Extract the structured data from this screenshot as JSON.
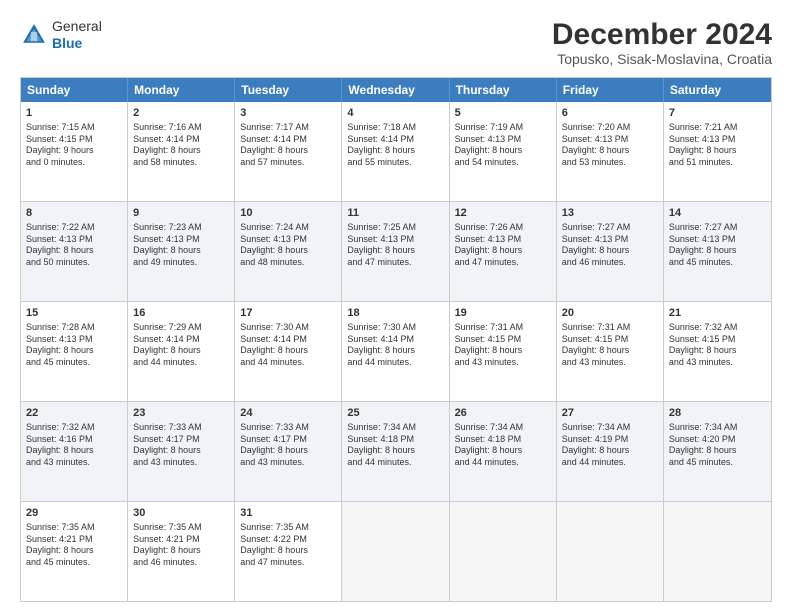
{
  "header": {
    "logo_general": "General",
    "logo_blue": "Blue",
    "title": "December 2024",
    "subtitle": "Topusko, Sisak-Moslavina, Croatia"
  },
  "weekdays": [
    "Sunday",
    "Monday",
    "Tuesday",
    "Wednesday",
    "Thursday",
    "Friday",
    "Saturday"
  ],
  "rows": [
    [
      {
        "day": "1",
        "lines": [
          "Sunrise: 7:15 AM",
          "Sunset: 4:15 PM",
          "Daylight: 9 hours",
          "and 0 minutes."
        ]
      },
      {
        "day": "2",
        "lines": [
          "Sunrise: 7:16 AM",
          "Sunset: 4:14 PM",
          "Daylight: 8 hours",
          "and 58 minutes."
        ]
      },
      {
        "day": "3",
        "lines": [
          "Sunrise: 7:17 AM",
          "Sunset: 4:14 PM",
          "Daylight: 8 hours",
          "and 57 minutes."
        ]
      },
      {
        "day": "4",
        "lines": [
          "Sunrise: 7:18 AM",
          "Sunset: 4:14 PM",
          "Daylight: 8 hours",
          "and 55 minutes."
        ]
      },
      {
        "day": "5",
        "lines": [
          "Sunrise: 7:19 AM",
          "Sunset: 4:13 PM",
          "Daylight: 8 hours",
          "and 54 minutes."
        ]
      },
      {
        "day": "6",
        "lines": [
          "Sunrise: 7:20 AM",
          "Sunset: 4:13 PM",
          "Daylight: 8 hours",
          "and 53 minutes."
        ]
      },
      {
        "day": "7",
        "lines": [
          "Sunrise: 7:21 AM",
          "Sunset: 4:13 PM",
          "Daylight: 8 hours",
          "and 51 minutes."
        ]
      }
    ],
    [
      {
        "day": "8",
        "lines": [
          "Sunrise: 7:22 AM",
          "Sunset: 4:13 PM",
          "Daylight: 8 hours",
          "and 50 minutes."
        ]
      },
      {
        "day": "9",
        "lines": [
          "Sunrise: 7:23 AM",
          "Sunset: 4:13 PM",
          "Daylight: 8 hours",
          "and 49 minutes."
        ]
      },
      {
        "day": "10",
        "lines": [
          "Sunrise: 7:24 AM",
          "Sunset: 4:13 PM",
          "Daylight: 8 hours",
          "and 48 minutes."
        ]
      },
      {
        "day": "11",
        "lines": [
          "Sunrise: 7:25 AM",
          "Sunset: 4:13 PM",
          "Daylight: 8 hours",
          "and 47 minutes."
        ]
      },
      {
        "day": "12",
        "lines": [
          "Sunrise: 7:26 AM",
          "Sunset: 4:13 PM",
          "Daylight: 8 hours",
          "and 47 minutes."
        ]
      },
      {
        "day": "13",
        "lines": [
          "Sunrise: 7:27 AM",
          "Sunset: 4:13 PM",
          "Daylight: 8 hours",
          "and 46 minutes."
        ]
      },
      {
        "day": "14",
        "lines": [
          "Sunrise: 7:27 AM",
          "Sunset: 4:13 PM",
          "Daylight: 8 hours",
          "and 45 minutes."
        ]
      }
    ],
    [
      {
        "day": "15",
        "lines": [
          "Sunrise: 7:28 AM",
          "Sunset: 4:13 PM",
          "Daylight: 8 hours",
          "and 45 minutes."
        ]
      },
      {
        "day": "16",
        "lines": [
          "Sunrise: 7:29 AM",
          "Sunset: 4:14 PM",
          "Daylight: 8 hours",
          "and 44 minutes."
        ]
      },
      {
        "day": "17",
        "lines": [
          "Sunrise: 7:30 AM",
          "Sunset: 4:14 PM",
          "Daylight: 8 hours",
          "and 44 minutes."
        ]
      },
      {
        "day": "18",
        "lines": [
          "Sunrise: 7:30 AM",
          "Sunset: 4:14 PM",
          "Daylight: 8 hours",
          "and 44 minutes."
        ]
      },
      {
        "day": "19",
        "lines": [
          "Sunrise: 7:31 AM",
          "Sunset: 4:15 PM",
          "Daylight: 8 hours",
          "and 43 minutes."
        ]
      },
      {
        "day": "20",
        "lines": [
          "Sunrise: 7:31 AM",
          "Sunset: 4:15 PM",
          "Daylight: 8 hours",
          "and 43 minutes."
        ]
      },
      {
        "day": "21",
        "lines": [
          "Sunrise: 7:32 AM",
          "Sunset: 4:15 PM",
          "Daylight: 8 hours",
          "and 43 minutes."
        ]
      }
    ],
    [
      {
        "day": "22",
        "lines": [
          "Sunrise: 7:32 AM",
          "Sunset: 4:16 PM",
          "Daylight: 8 hours",
          "and 43 minutes."
        ]
      },
      {
        "day": "23",
        "lines": [
          "Sunrise: 7:33 AM",
          "Sunset: 4:17 PM",
          "Daylight: 8 hours",
          "and 43 minutes."
        ]
      },
      {
        "day": "24",
        "lines": [
          "Sunrise: 7:33 AM",
          "Sunset: 4:17 PM",
          "Daylight: 8 hours",
          "and 43 minutes."
        ]
      },
      {
        "day": "25",
        "lines": [
          "Sunrise: 7:34 AM",
          "Sunset: 4:18 PM",
          "Daylight: 8 hours",
          "and 44 minutes."
        ]
      },
      {
        "day": "26",
        "lines": [
          "Sunrise: 7:34 AM",
          "Sunset: 4:18 PM",
          "Daylight: 8 hours",
          "and 44 minutes."
        ]
      },
      {
        "day": "27",
        "lines": [
          "Sunrise: 7:34 AM",
          "Sunset: 4:19 PM",
          "Daylight: 8 hours",
          "and 44 minutes."
        ]
      },
      {
        "day": "28",
        "lines": [
          "Sunrise: 7:34 AM",
          "Sunset: 4:20 PM",
          "Daylight: 8 hours",
          "and 45 minutes."
        ]
      }
    ],
    [
      {
        "day": "29",
        "lines": [
          "Sunrise: 7:35 AM",
          "Sunset: 4:21 PM",
          "Daylight: 8 hours",
          "and 45 minutes."
        ]
      },
      {
        "day": "30",
        "lines": [
          "Sunrise: 7:35 AM",
          "Sunset: 4:21 PM",
          "Daylight: 8 hours",
          "and 46 minutes."
        ]
      },
      {
        "day": "31",
        "lines": [
          "Sunrise: 7:35 AM",
          "Sunset: 4:22 PM",
          "Daylight: 8 hours",
          "and 47 minutes."
        ]
      },
      {
        "day": "",
        "lines": []
      },
      {
        "day": "",
        "lines": []
      },
      {
        "day": "",
        "lines": []
      },
      {
        "day": "",
        "lines": []
      }
    ]
  ]
}
